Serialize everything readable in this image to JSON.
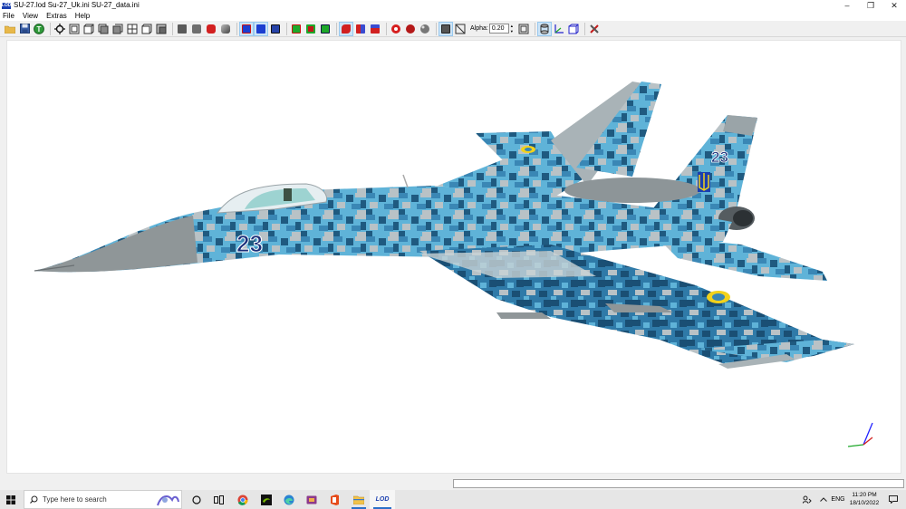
{
  "window": {
    "app_icon_label": "LOD",
    "title": "SU-27.lod  Su-27_Uk.ini  SU-27_data.ini",
    "controls": {
      "minimize": "–",
      "maximize": "❐",
      "close": "✕"
    }
  },
  "menu": [
    "File",
    "View",
    "Extras",
    "Help"
  ],
  "toolbar": {
    "alpha_label": "Alpha:",
    "alpha_value": "0.20",
    "spin_up": "▲",
    "spin_down": "▼"
  },
  "viewport": {
    "aircraft_number": "23",
    "tail_number": "23",
    "background": "#ffffff"
  },
  "taskbar": {
    "search_placeholder": "Type here to search",
    "lod_label": "LOD",
    "lang": "ENG",
    "time": "11:20 PM",
    "date": "18/10/2022"
  },
  "colors": {
    "camo_light": "#5fb3d8",
    "camo_mid": "#3a87b5",
    "camo_dark": "#1f5a80",
    "camo_grey": "#b9c2c6",
    "nose_grey": "#8f9698",
    "accent_blue": "#1a3fb0",
    "taskbar_underline": "#2a6fc9"
  }
}
